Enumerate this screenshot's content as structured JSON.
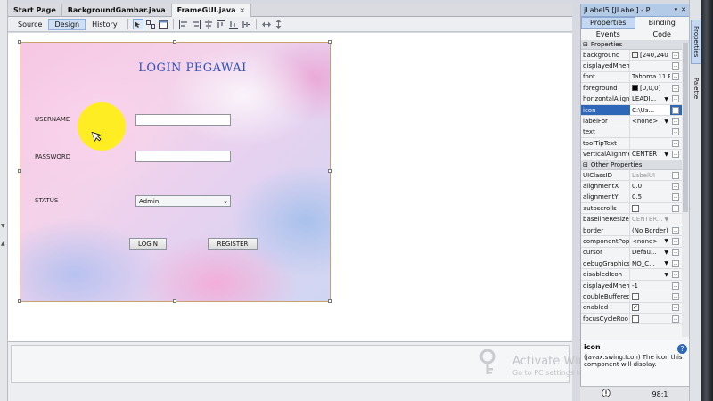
{
  "editor_tabs": [
    {
      "label": "Start Page"
    },
    {
      "label": "BackgroundGambar.java"
    },
    {
      "label": "FrameGUI.java",
      "close": "×"
    }
  ],
  "view_tabs": {
    "source": "Source",
    "design": "Design",
    "history": "History"
  },
  "form": {
    "title": "LOGIN PEGAWAI",
    "username_label": "USERNAME",
    "password_label": "PASSWORD",
    "status_label": "STATUS",
    "status_selected": "Admin",
    "login_button": "LOGIN",
    "register_button": "REGISTER"
  },
  "properties_panel": {
    "title": "jLabel5 [JLabel] - P...",
    "tabs": [
      "Properties",
      "Binding",
      "Events",
      "Code"
    ],
    "section_properties": "Properties",
    "section_other": "Other Properties",
    "rows": [
      {
        "name": "background",
        "value": "[240,240"
      },
      {
        "name": "displayedMnem",
        "value": ""
      },
      {
        "name": "font",
        "value": "Tahoma 11 P"
      },
      {
        "name": "foreground",
        "value": "[0,0,0]"
      },
      {
        "name": "horizontalAlignm",
        "value": "LEADI..."
      },
      {
        "name": "icon",
        "value": "C:\\Us..."
      },
      {
        "name": "labelFor",
        "value": "<none>"
      },
      {
        "name": "text",
        "value": ""
      },
      {
        "name": "toolTipText",
        "value": ""
      },
      {
        "name": "verticalAlignme",
        "value": "CENTER"
      }
    ],
    "other_rows": [
      {
        "name": "UIClassID",
        "value": "LabelUI"
      },
      {
        "name": "alignmentX",
        "value": "0.0"
      },
      {
        "name": "alignmentY",
        "value": "0.5"
      },
      {
        "name": "autoscrolls",
        "value": ""
      },
      {
        "name": "baselineResize",
        "value": "CENTER..."
      },
      {
        "name": "border",
        "value": "(No Border)"
      },
      {
        "name": "componentPopu",
        "value": "<none>"
      },
      {
        "name": "cursor",
        "value": "Defau..."
      },
      {
        "name": "debugGraphics",
        "value": "NO_C..."
      },
      {
        "name": "disabledIcon",
        "value": ""
      },
      {
        "name": "displayedMnem",
        "value": "-1"
      },
      {
        "name": "doubleBuffered",
        "value": ""
      },
      {
        "name": "enabled",
        "value": "✓"
      },
      {
        "name": "focusCycleRoo",
        "value": ""
      }
    ],
    "help_title": "icon",
    "help_text": "(javax.swing.Icon) The icon this component will display."
  },
  "status": {
    "position": "98:1"
  },
  "side_tabs": {
    "properties": "Properties",
    "palette": "Palette"
  },
  "watermark": {
    "line1": "Activate Windows",
    "line2": "Go to PC settings to activate Windows."
  },
  "colors": {
    "title_blue": "#2f52b8",
    "selection_blue": "#2e66b8",
    "highlight_yellow": "#fff200"
  }
}
